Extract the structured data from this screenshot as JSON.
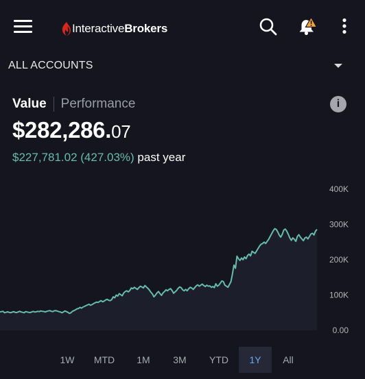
{
  "header": {
    "logo_text_regular": "Interactive",
    "logo_text_bold": "Brokers",
    "brand_color": "#d6271c",
    "icons": [
      "menu-icon",
      "search-icon",
      "bell-warning-icon",
      "more-vertical-icon"
    ],
    "warning_color": "#f2a43a"
  },
  "accounts": {
    "label": "ALL ACCOUNTS"
  },
  "tabs": [
    {
      "label": "Value",
      "active": true
    },
    {
      "label": "Performance",
      "active": false
    }
  ],
  "info_icon_glyph": "i",
  "portfolio": {
    "value_main": "$282,286.",
    "value_cents": "07",
    "change_amount": "$227,781.02 (427.03%)",
    "change_period": " past year",
    "gain_color": "#66bcae"
  },
  "chart_data": {
    "type": "line",
    "y_ticks": [
      "400K",
      "300K",
      "200K",
      "100K",
      "0.00"
    ],
    "ylim": [
      0,
      400000
    ],
    "color": "#66bcae",
    "fill": "#1c1f2b",
    "values": [
      52000,
      53000,
      54000,
      50000,
      51000,
      52500,
      51000,
      50000,
      51500,
      53000,
      51000,
      50500,
      52000,
      54000,
      52000,
      51000,
      50000,
      53000,
      52000,
      51000,
      50500,
      52000,
      53500,
      52000,
      52500,
      54000,
      53000,
      55000,
      54000,
      53500,
      52000,
      54000,
      55000,
      56000,
      54000,
      53000,
      55500,
      56000,
      54500,
      53000,
      52000,
      50000,
      52000,
      55000,
      53000,
      51000,
      48000,
      50000,
      54000,
      56000,
      58000,
      61000,
      62000,
      65000,
      63000,
      66000,
      68000,
      70000,
      72000,
      74000,
      71000,
      73000,
      76000,
      78000,
      80000,
      79000,
      82000,
      84000,
      81000,
      83000,
      86000,
      88000,
      85000,
      84000,
      87000,
      95000,
      92000,
      100000,
      97000,
      104000,
      101000,
      98000,
      106000,
      110000,
      112000,
      109000,
      113000,
      120000,
      118000,
      122000,
      119000,
      116000,
      121000,
      125000,
      123000,
      120000,
      127000,
      123000,
      119000,
      114000,
      108000,
      103000,
      95000,
      100000,
      106000,
      110000,
      104000,
      99000,
      106000,
      110000,
      115000,
      112000,
      116000,
      118000,
      113000,
      105000,
      109000,
      113000,
      119000,
      123000,
      121000,
      115000,
      112000,
      116000,
      112000,
      118000,
      122000,
      120000,
      116000,
      121000,
      126000,
      129000,
      125000,
      128000,
      131000,
      127000,
      124000,
      128000,
      125000,
      126000,
      122000,
      124000,
      121000,
      132000,
      125000,
      128000,
      134000,
      140000,
      138000,
      128000,
      125000,
      122000,
      130000,
      138000,
      160000,
      185000,
      176000,
      210000,
      203000,
      198000,
      205000,
      200000,
      208000,
      203000,
      212000,
      216000,
      211000,
      224000,
      221000,
      218000,
      225000,
      232000,
      239000,
      244000,
      246000,
      250000,
      246000,
      252000,
      258000,
      266000,
      274000,
      282000,
      288000,
      286000,
      279000,
      270000,
      264000,
      272000,
      284000,
      287000,
      281000,
      272000,
      262000,
      255000,
      262000,
      258000,
      252000,
      266000,
      271000,
      264000,
      259000,
      254000,
      262000,
      264000,
      259000,
      266000,
      273000,
      275000,
      270000,
      281000,
      286000
    ],
    "grid": false
  },
  "ranges": [
    {
      "label": "1W",
      "selected": false
    },
    {
      "label": "MTD",
      "selected": false
    },
    {
      "label": "1M",
      "selected": false
    },
    {
      "label": "3M",
      "selected": false
    },
    {
      "label": "YTD",
      "selected": false
    },
    {
      "label": "1Y",
      "selected": true
    },
    {
      "label": "All",
      "selected": false
    }
  ]
}
